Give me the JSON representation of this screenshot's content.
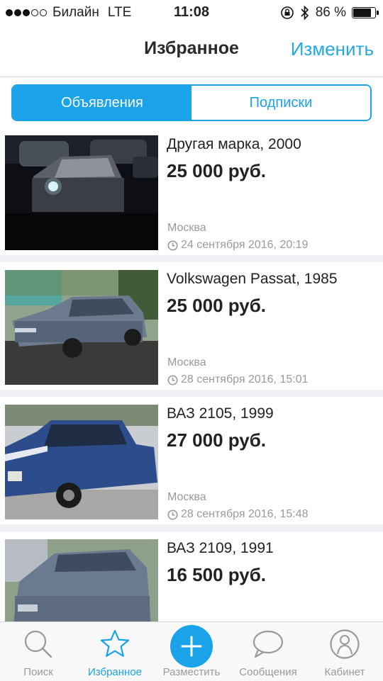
{
  "status_bar": {
    "carrier": "Билайн",
    "network": "LTE",
    "time": "11:08",
    "battery": "86 %",
    "battery_level": 0.86,
    "signal_bars": 3
  },
  "nav": {
    "title": "Избранное",
    "edit": "Изменить"
  },
  "segments": {
    "ads": "Объявления",
    "subscriptions": "Подписки",
    "active": "ads"
  },
  "listings": [
    {
      "title": "Другая марка, 2000",
      "price": "25 000 руб.",
      "city": "Москва",
      "date": "24 сентября 2016, 20:19"
    },
    {
      "title": "Volkswagen Passat, 1985",
      "price": "25 000 руб.",
      "city": "Москва",
      "date": "28 сентября 2016, 15:01"
    },
    {
      "title": "ВАЗ 2105, 1999",
      "price": "27 000 руб.",
      "city": "Москва",
      "date": "28 сентября 2016, 15:48"
    },
    {
      "title": "ВАЗ 2109, 1991",
      "price": "16 500 руб.",
      "city": "",
      "date": ""
    }
  ],
  "tabs": [
    {
      "label": "Поиск",
      "icon": "search-icon"
    },
    {
      "label": "Избранное",
      "icon": "star-icon"
    },
    {
      "label": "Разместить",
      "icon": "plus-icon"
    },
    {
      "label": "Сообщения",
      "icon": "chat-bubble-icon"
    },
    {
      "label": "Кабинет",
      "icon": "user-icon"
    }
  ],
  "colors": {
    "accent": "#1aa3e8",
    "muted": "#9a9a9a"
  }
}
